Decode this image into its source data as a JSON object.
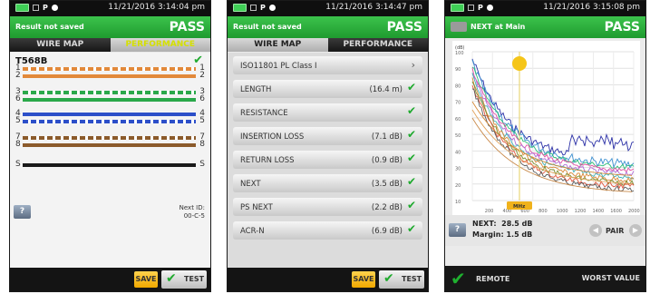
{
  "screens": [
    {
      "time": "11/21/2016 3:14:04 pm",
      "result_status": "Result not saved",
      "verdict": "PASS",
      "tabs": [
        {
          "label": "WIRE MAP",
          "active": false
        },
        {
          "label": "PERFORMANCE",
          "active": true
        }
      ],
      "standard": "T568B",
      "wires": [
        {
          "left": "1",
          "right": "1",
          "color": "#e2893a",
          "style": "striped"
        },
        {
          "left": "2",
          "right": "2",
          "color": "#e2893a",
          "style": "solid"
        },
        {
          "left": "3",
          "right": "3",
          "color": "#2aa84a",
          "style": "striped"
        },
        {
          "left": "6",
          "right": "6",
          "color": "#2aa84a",
          "style": "solid"
        },
        {
          "left": "4",
          "right": "4",
          "color": "#2c4fc9",
          "style": "solid"
        },
        {
          "left": "5",
          "right": "5",
          "color": "#2c4fc9",
          "style": "striped"
        },
        {
          "left": "7",
          "right": "7",
          "color": "#8b5a2b",
          "style": "striped"
        },
        {
          "left": "8",
          "right": "8",
          "color": "#8b5a2b",
          "style": "solid"
        },
        {
          "left": "S",
          "right": "S",
          "color": "#1a1a1a",
          "style": "solid"
        }
      ],
      "next_id_label": "Next ID:",
      "next_id_value": "00-C-5",
      "help_label": "?",
      "save_label": "SAVE",
      "test_label": "TEST"
    },
    {
      "time": "11/21/2016 3:14:47 pm",
      "result_status": "Result not saved",
      "verdict": "PASS",
      "tabs": [
        {
          "label": "WIRE MAP",
          "active": true
        },
        {
          "label": "PERFORMANCE",
          "active": false
        }
      ],
      "rows": [
        {
          "name": "ISO11801 PL Class I",
          "value": "",
          "status": "arrow"
        },
        {
          "name": "LENGTH",
          "value": "(16.4 m)",
          "status": "pass"
        },
        {
          "name": "RESISTANCE",
          "value": "",
          "status": "pass"
        },
        {
          "name": "INSERTION LOSS",
          "value": "(7.1 dB)",
          "status": "pass"
        },
        {
          "name": "RETURN LOSS",
          "value": "(0.9 dB)",
          "status": "pass"
        },
        {
          "name": "NEXT",
          "value": "(3.5 dB)",
          "status": "pass"
        },
        {
          "name": "PS NEXT",
          "value": "(2.2 dB)",
          "status": "pass"
        },
        {
          "name": "ACR-N",
          "value": "(6.9 dB)",
          "status": "pass"
        }
      ],
      "save_label": "SAVE",
      "test_label": "TEST"
    },
    {
      "time": "11/21/2016 3:15:08 pm",
      "title": "NEXT at Main",
      "verdict": "PASS",
      "next_label": "NEXT:",
      "next_value": "28.5 dB",
      "margin_label": "Margin:",
      "margin_value": "1.5 dB",
      "pair_label": "PAIR",
      "help_label": "?",
      "remote_label": "REMOTE",
      "worst_label": "WORST VALUE",
      "cursor_label": "MHz",
      "marker_color": "#f5c518",
      "x_ticks": [
        "200",
        "400",
        "600",
        "800",
        "1000",
        "1200",
        "1400",
        "1600",
        "2000"
      ],
      "y_ticks": [
        "100",
        "90",
        "80",
        "70",
        "60",
        "50",
        "40",
        "30",
        "20",
        "10"
      ],
      "y_top_label": "(dB)"
    }
  ],
  "colors": {
    "header_green": "#2bb33b",
    "save_yellow": "#f4b400",
    "check_green": "#1faa2e"
  }
}
